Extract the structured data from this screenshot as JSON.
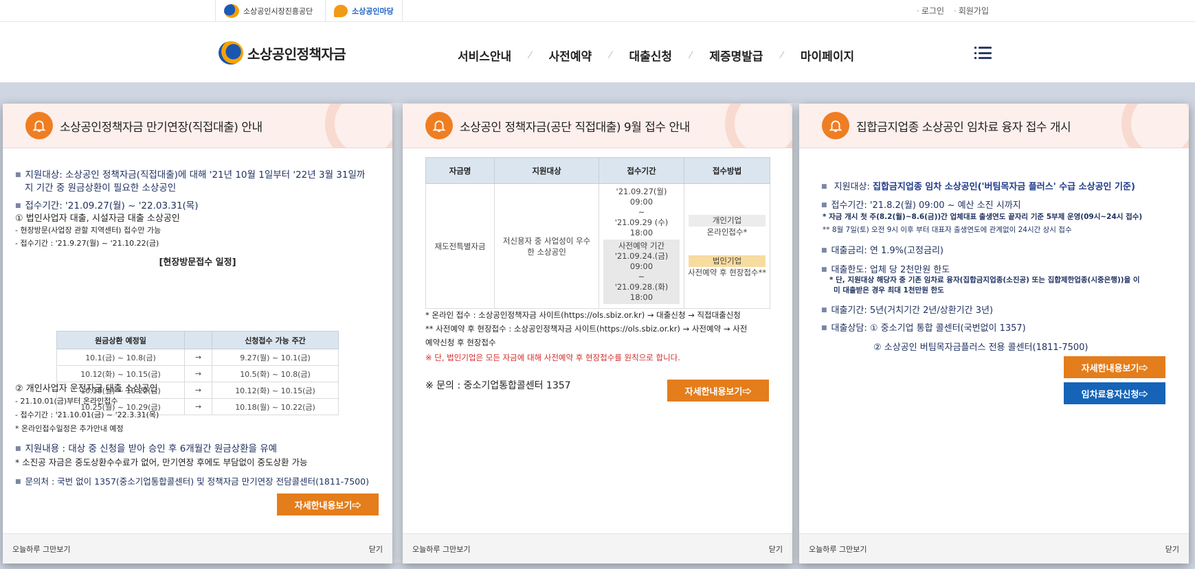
{
  "topbar": {
    "org1": "소상공인시장진흥공단",
    "org2": "소상공인마당",
    "login": "로그인",
    "join": "회원가입"
  },
  "header": {
    "brand": "소상공인정책자금",
    "nav": [
      "서비스안내",
      "사전예약",
      "대출신청",
      "제증명발급",
      "마이페이지"
    ]
  },
  "popup1": {
    "title": "소상공인정책자금 만기연장(직접대출) 안내",
    "target_1": "지원대상: 소상공인 정책자금(직접대출)에 대해 '21년 10월 1일부터 '22년 3월 31일까",
    "target_2": "지 기간 중 원금상환이 필요한 소상공인",
    "period": "접수기간: '21.09.27(월) ~ '22.03.31(목)",
    "case1": "① 법인사업자 대출, 시설자금 대출 소상공인",
    "case1_a": "- 현장방문(사업장 관할 지역센터) 접수만 가능",
    "case1_b": "- 접수기간 : '21.9.27(월) ~ '21.10.22(금)",
    "schedule_title": "[현장방문접수 일정]",
    "schedule_headers": [
      "원금상환 예정일",
      "",
      "신청접수 가능 주간"
    ],
    "schedule_rows": [
      [
        "10.1(금) ~ 10.8(금)",
        "→",
        "9.27(월) ~ 10.1(금)"
      ],
      [
        "10.12(화) ~ 10.15(금)",
        "→",
        "10.5(화) ~ 10.8(금)"
      ],
      [
        "10.18(월) ~ 10.22(금)",
        "→",
        "10.12(화) ~ 10.15(금)"
      ],
      [
        "10.25(월) ~ 10.29(금)",
        "→",
        "10.18(월) ~ 10.22(금)"
      ]
    ],
    "case2": "② 개인사업자 운전자금 대출 소상공인",
    "case2_a": "- 21.10.01(금)부터 온라인접수",
    "case2_b": "- 접수기간 : '21.10.01(금) ~ '22.3.31(목)",
    "case2_c": "* 온라인접수일정은 추가안내 예정",
    "support": "지원내용 : 대상 중 신청을 받아 승인 후 6개월간 원금상환을 유예",
    "support_note": "* 소진공 자금은 중도상환수수료가 없어, 만기연장 후에도 부담없이 중도상환 가능",
    "contact": "문의처 : 국번 없이 1357(중소기업통합콜센터) 및 정책자금 만기연장 전담콜센터(1811-7500)",
    "detail_btn": "자세한내용보기⇨",
    "dismiss": "오늘하루 그만보기",
    "close": "닫기"
  },
  "popup2": {
    "title": "소상공인 정책자금(공단 직접대출) 9월 접수 안내",
    "table_headers": [
      "자금명",
      "지원대상",
      "접수기간",
      "접수방법"
    ],
    "fund_name": "재도전특별자금",
    "fund_target": "저신용자 중 사업성이 우수한 소상공인",
    "period_online": [
      "'21.09.27(월)",
      "09:00",
      "~",
      "'21.09.29 (수)",
      "18:00"
    ],
    "period_offline": [
      "사전예약 기간",
      "'21.09.24.(금)",
      "09:00",
      "~",
      "'21.09.28.(화)",
      "18:00"
    ],
    "method_individual": "개인기업",
    "method_individual_desc": "온라인접수*",
    "method_corp": "법인기업",
    "method_corp_desc": "사전예약 후 현장접수**",
    "note1": "* 온라인 접수 : 소상공인정책자금 사이트(https://ols.sbiz.or.kr) → 대출신청 → 직접대출신청",
    "note2a": "** 사전예약 후 현장접수 : 소상공인정책자금 사이트(https://ols.sbiz.or.kr) → 사전예약 → 사전",
    "note2b": "예약신청 후 현장접수",
    "warning": "※ 단, 법인기업은 모든 자금에 대해 사전예약 후 현장접수를 원칙으로 합니다.",
    "inquiry": "※ 문의 : 중소기업통합콜센터 1357",
    "detail_btn": "자세한내용보기⇨",
    "dismiss": "오늘하루 그만보기",
    "close": "닫기"
  },
  "popup3": {
    "title": "집합금지업종 소상공인 임차료 융자 접수 개시",
    "target_label": "지원대상: ",
    "target_value": "집합금지업종 임차 소상공인('버팀목자금 플러스' 수급 소상공인 기준)",
    "period": "접수기간: '21.8.2(월) 09:00 ~ 예산 소진 시까지",
    "period_note1": "* 자금 개시 첫 주(8.2(월)~8.6(금))간 업체대표 출생연도 끝자리 기준 5부제 운영(09시~24시 접수)",
    "period_note2": "** 8월 7일(토) 오전 9시 이후 부터 대표자 출생연도에 관계없이 24시간 상시 접수",
    "rate": "대출금리: 연 1.9%(고정금리)",
    "limit": "대출한도: 업체 당 2천만원 한도",
    "limit_note1": "* 단, 지원대상 해당자 중 기존 임차료 융자(집합금지업종(소진공) 또는 집합제한업종(시중은행))을 이",
    "limit_note2": "미 대출받은 경우 최대 1천만원 한도",
    "term": "대출기간: 5년(거치기간 2년/상환기간 3년)",
    "consult": "대출상담: ① 중소기업 통합 콜센터(국번없이 1357)",
    "consult2": "② 소상공인 버팀목자금플러스 전용 콜센터(1811-7500)",
    "detail_btn": "자세한내용보기⇨",
    "apply_btn": "임차료융자신청⇨",
    "dismiss": "오늘하루 그만보기",
    "close": "닫기"
  }
}
